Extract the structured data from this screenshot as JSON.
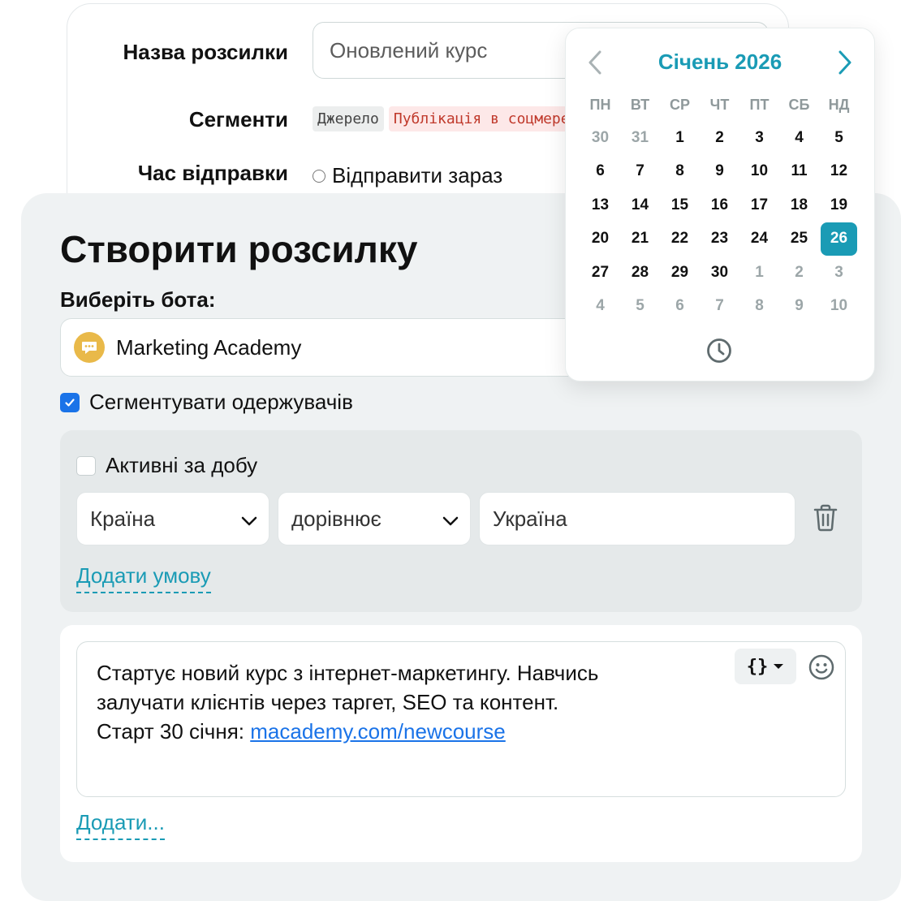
{
  "back_form": {
    "name_label": "Назва розсилки",
    "name_value": "Оновлений курс",
    "segments_label": "Сегменти",
    "tags": [
      "Джерело",
      "Публікація в соцмережах"
    ],
    "send_time_label": "Час відправки",
    "send_now_label": "Відправити зараз"
  },
  "main": {
    "title": "Створити розсилку",
    "bot_label": "Виберіть бота:",
    "bot_name": "Marketing Academy",
    "segment_checkbox_label": "Сегментувати одержувачів",
    "segment_checked": true
  },
  "conditions": {
    "active_label": "Активні за добу",
    "field": "Країна",
    "operator": "дорівнює",
    "value": "Україна",
    "add_condition": "Додати умову"
  },
  "message": {
    "line1": "Стартує новий курс з інтернет-маркетингу. Навчись",
    "line2": "залучати клієнтів через таргет, SEO та контент.",
    "line3_prefix": "Старт 30 січня: ",
    "link": "macademy.com/newcourse",
    "vars_label": "{}",
    "add_label": "Додати..."
  },
  "calendar": {
    "month_title": "Січень 2026",
    "weekdays": [
      "ПН",
      "ВТ",
      "СР",
      "ЧТ",
      "ПТ",
      "СБ",
      "НД"
    ],
    "days": [
      [
        "30",
        "muted"
      ],
      [
        "31",
        "muted"
      ],
      [
        "1",
        ""
      ],
      [
        "2",
        ""
      ],
      [
        "3",
        ""
      ],
      [
        "4",
        ""
      ],
      [
        "5",
        ""
      ],
      [
        "6",
        ""
      ],
      [
        "7",
        ""
      ],
      [
        "8",
        ""
      ],
      [
        "9",
        ""
      ],
      [
        "10",
        ""
      ],
      [
        "11",
        ""
      ],
      [
        "12",
        ""
      ],
      [
        "13",
        ""
      ],
      [
        "14",
        ""
      ],
      [
        "15",
        ""
      ],
      [
        "16",
        ""
      ],
      [
        "17",
        ""
      ],
      [
        "18",
        ""
      ],
      [
        "19",
        ""
      ],
      [
        "20",
        ""
      ],
      [
        "21",
        ""
      ],
      [
        "22",
        ""
      ],
      [
        "23",
        ""
      ],
      [
        "24",
        ""
      ],
      [
        "25",
        ""
      ],
      [
        "26",
        "selected"
      ],
      [
        "27",
        ""
      ],
      [
        "28",
        ""
      ],
      [
        "29",
        ""
      ],
      [
        "30",
        ""
      ],
      [
        "1",
        "muted"
      ],
      [
        "2",
        "muted"
      ],
      [
        "3",
        "muted"
      ],
      [
        "4",
        "muted"
      ],
      [
        "5",
        "muted"
      ],
      [
        "6",
        "muted"
      ],
      [
        "7",
        "muted"
      ],
      [
        "8",
        "muted"
      ],
      [
        "9",
        "muted"
      ],
      [
        "10",
        "muted"
      ]
    ],
    "accent_color": "#1a9bb5"
  },
  "colors": {
    "accent": "#1a9bb5",
    "checkbox": "#1a73e8",
    "link": "#1a73e8",
    "panel_bg": "#eff2f3"
  },
  "icons": [
    "chat-bubble-icon",
    "check-icon",
    "chevron-down-icon",
    "trash-icon",
    "chevron-left-icon",
    "chevron-right-icon",
    "clock-icon",
    "smiley-icon",
    "caret-down-icon"
  ]
}
